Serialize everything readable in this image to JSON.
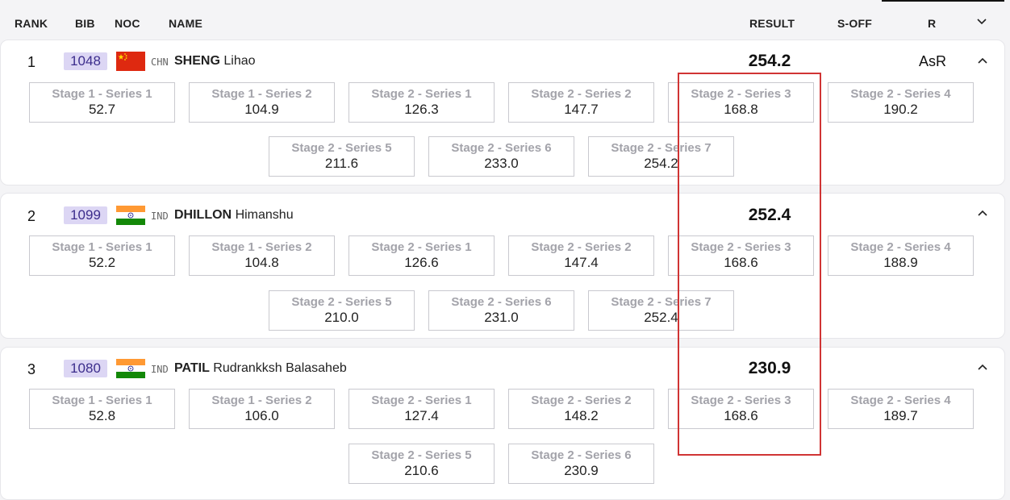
{
  "columns": {
    "rank": "RANK",
    "bib": "BIB",
    "noc": "NOC",
    "name": "NAME",
    "result": "RESULT",
    "soff": "S-OFF",
    "r": "R"
  },
  "athletes": [
    {
      "rank": "1",
      "bib": "1048",
      "noc": "CHN",
      "surname": "SHENG",
      "given": "Lihao",
      "result": "254.2",
      "record": "AsR",
      "flag": "china",
      "series": [
        {
          "label": "Stage 1 - Series 1",
          "value": "52.7"
        },
        {
          "label": "Stage 1 - Series 2",
          "value": "104.9"
        },
        {
          "label": "Stage 2 - Series 1",
          "value": "126.3"
        },
        {
          "label": "Stage 2 - Series 2",
          "value": "147.7"
        },
        {
          "label": "Stage 2 - Series 3",
          "value": "168.8"
        },
        {
          "label": "Stage 2 - Series 4",
          "value": "190.2"
        },
        {
          "label": "Stage 2 - Series 5",
          "value": "211.6"
        },
        {
          "label": "Stage 2 - Series 6",
          "value": "233.0"
        },
        {
          "label": "Stage 2 - Series 7",
          "value": "254.2"
        }
      ]
    },
    {
      "rank": "2",
      "bib": "1099",
      "noc": "IND",
      "surname": "DHILLON",
      "given": "Himanshu",
      "result": "252.4",
      "record": "",
      "flag": "india",
      "series": [
        {
          "label": "Stage 1 - Series 1",
          "value": "52.2"
        },
        {
          "label": "Stage 1 - Series 2",
          "value": "104.8"
        },
        {
          "label": "Stage 2 - Series 1",
          "value": "126.6"
        },
        {
          "label": "Stage 2 - Series 2",
          "value": "147.4"
        },
        {
          "label": "Stage 2 - Series 3",
          "value": "168.6"
        },
        {
          "label": "Stage 2 - Series 4",
          "value": "188.9"
        },
        {
          "label": "Stage 2 - Series 5",
          "value": "210.0"
        },
        {
          "label": "Stage 2 - Series 6",
          "value": "231.0"
        },
        {
          "label": "Stage 2 - Series 7",
          "value": "252.4"
        }
      ]
    },
    {
      "rank": "3",
      "bib": "1080",
      "noc": "IND",
      "surname": "PATIL",
      "given": "Rudrankksh Balasaheb",
      "result": "230.9",
      "record": "",
      "flag": "india",
      "series": [
        {
          "label": "Stage 1 - Series 1",
          "value": "52.8"
        },
        {
          "label": "Stage 1 - Series 2",
          "value": "106.0"
        },
        {
          "label": "Stage 2 - Series 1",
          "value": "127.4"
        },
        {
          "label": "Stage 2 - Series 2",
          "value": "148.2"
        },
        {
          "label": "Stage 2 - Series 3",
          "value": "168.6"
        },
        {
          "label": "Stage 2 - Series 4",
          "value": "189.7"
        },
        {
          "label": "Stage 2 - Series 5",
          "value": "210.6"
        },
        {
          "label": "Stage 2 - Series 6",
          "value": "230.9"
        }
      ]
    }
  ],
  "colors": {
    "highlight": "#d03434",
    "bib_bg": "#dcd6f4",
    "bib_text": "#3c2d8c"
  },
  "icons": {
    "expand": "chevron-down-icon",
    "collapse": "chevron-up-icon"
  }
}
